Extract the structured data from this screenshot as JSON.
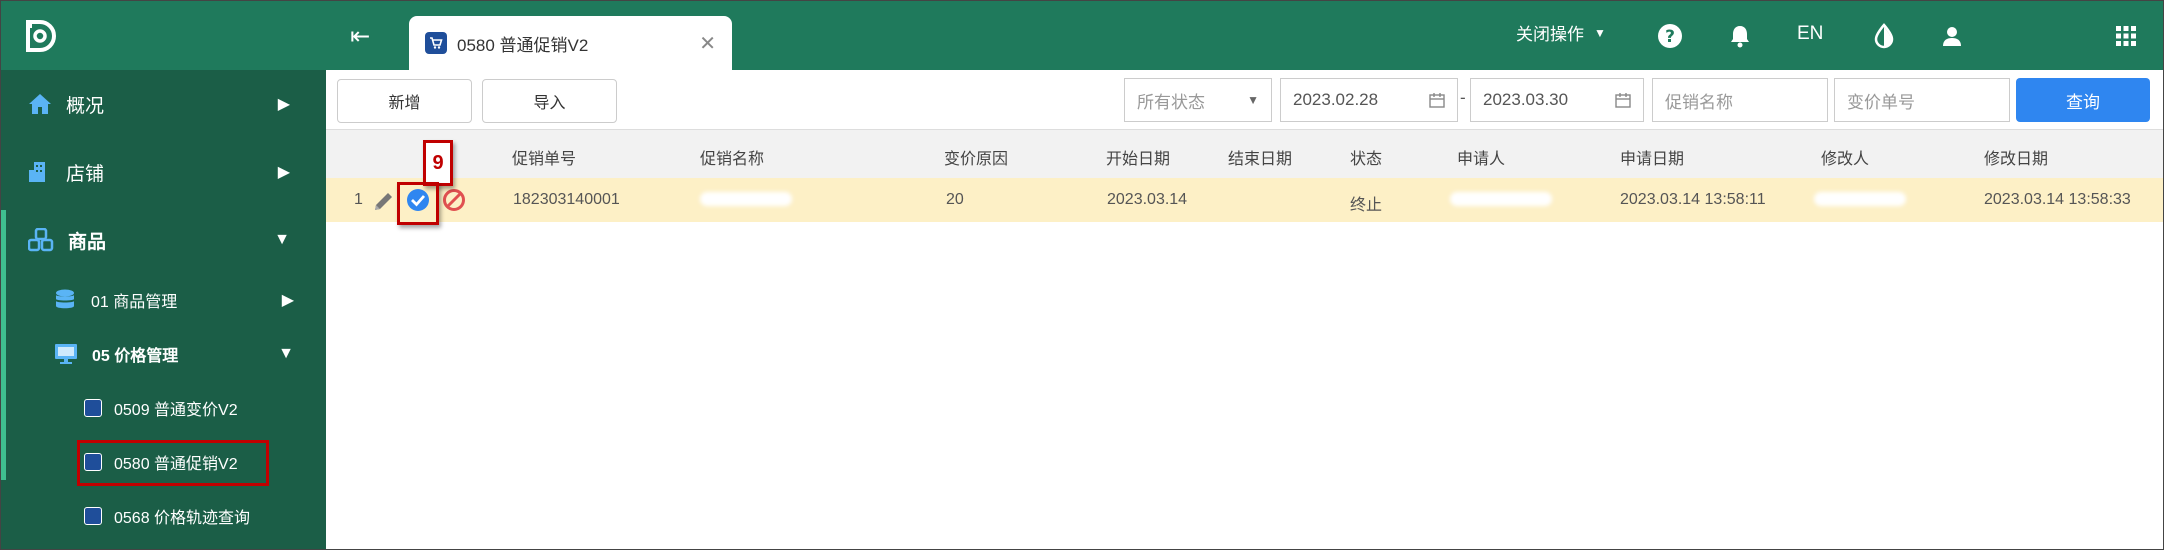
{
  "tab": {
    "label": "0580 普通促销V2"
  },
  "top_actions": {
    "close_ops": "关闭操作",
    "lang": "EN"
  },
  "sidebar": {
    "items": [
      {
        "label": "概况"
      },
      {
        "label": "店铺"
      },
      {
        "label": "商品"
      },
      {
        "label": "01 商品管理"
      },
      {
        "label": "05 价格管理"
      },
      {
        "label": "0509 普通变价V2"
      },
      {
        "label": "0580 普通促销V2"
      },
      {
        "label": "0568 价格轨迹查询"
      }
    ]
  },
  "toolbar": {
    "add_label": "新增",
    "import_label": "导入",
    "status_select": "所有状态",
    "date_from": "2023.02.28",
    "date_sep": "-",
    "date_to": "2023.03.30",
    "promo_name_placeholder": "促销名称",
    "change_no_placeholder": "变价单号",
    "query_label": "查询"
  },
  "table": {
    "columns": [
      "促销单号",
      "促销名称",
      "变价原因",
      "开始日期",
      "结束日期",
      "状态",
      "申请人",
      "申请日期",
      "修改人",
      "修改日期"
    ],
    "rows": [
      {
        "index": "1",
        "promo_no": "182303140001",
        "promo_name": "",
        "reason": "20",
        "start_date": "2023.03.14",
        "end_date": "",
        "status": "终止",
        "applicant": "",
        "apply_date": "2023.03.14 13:58:11",
        "modifier": "",
        "modify_date": "2023.03.14 13:58:33"
      }
    ]
  },
  "annotation": {
    "step": "9"
  },
  "colors": {
    "header": "#1f7a5c",
    "sidebar": "#1b5e47",
    "accent": "#2f86f0",
    "row_highlight": "#fdf0c6",
    "callout": "#c00000"
  }
}
